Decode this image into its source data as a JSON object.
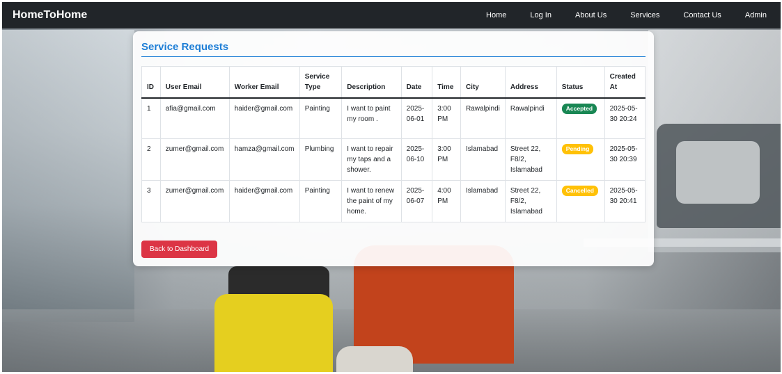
{
  "navbar": {
    "brand": "HomeToHome",
    "links": [
      "Home",
      "Log In",
      "About Us",
      "Services",
      "Contact Us",
      "Admin"
    ]
  },
  "page": {
    "title": "Service Requests",
    "back_button": "Back to Dashboard"
  },
  "table": {
    "headers": [
      "ID",
      "User Email",
      "Worker Email",
      "Service Type",
      "Description",
      "Date",
      "Time",
      "City",
      "Address",
      "Status",
      "Created At"
    ],
    "rows": [
      {
        "id": "1",
        "user_email": "afia@gmail.com",
        "worker_email": "haider@gmail.com",
        "service_type": "Painting",
        "description": "I want to paint my room .",
        "date": "2025-06-01",
        "time": "3:00 PM",
        "city": "Rawalpindi",
        "address": "Rawalpindi",
        "status": "Accepted",
        "created_at": "2025-05-30 20:24"
      },
      {
        "id": "2",
        "user_email": "zumer@gmail.com",
        "worker_email": "hamza@gmail.com",
        "service_type": "Plumbing",
        "description": "I want to repair my taps and a shower.",
        "date": "2025-06-10",
        "time": "3:00 PM",
        "city": "Islamabad",
        "address": "Street 22, F8/2, Islamabad",
        "status": "Pending",
        "created_at": "2025-05-30 20:39"
      },
      {
        "id": "3",
        "user_email": "zumer@gmail.com",
        "worker_email": "haider@gmail.com",
        "service_type": "Painting",
        "description": "I want to renew the paint of my home.",
        "date": "2025-06-07",
        "time": "4:00 PM",
        "city": "Islamabad",
        "address": "Street 22, F8/2, Islamabad",
        "status": "Cancelled",
        "created_at": "2025-05-30 20:41"
      }
    ]
  },
  "colors": {
    "navbar_bg": "#212529",
    "title_blue": "#1e7ed6",
    "accepted": "#198754",
    "pending": "#ffc107",
    "cancelled": "#ffc107",
    "back_button": "#dc3545"
  }
}
